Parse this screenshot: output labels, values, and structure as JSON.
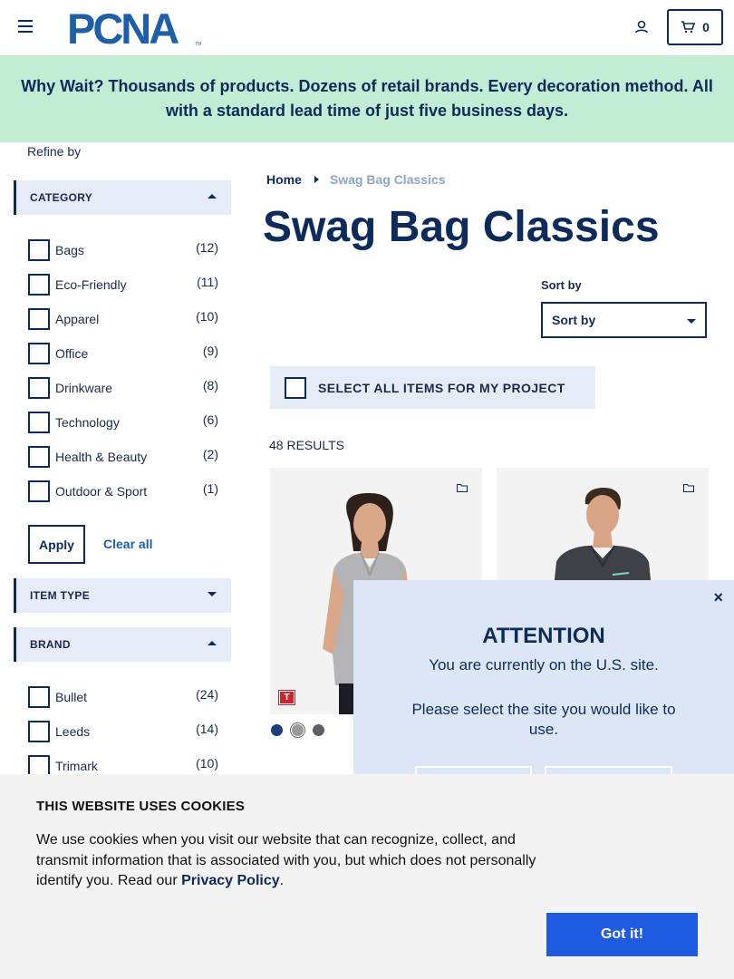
{
  "header": {
    "logo_text": "PCNA",
    "cart_count": "0"
  },
  "banner": {
    "text": "Why Wait? Thousands of products. Dozens of retail brands. Every decoration method. All with a standard lead time of just five business days."
  },
  "sidebar": {
    "refine_label": "Refine by",
    "category": {
      "label": "CATEGORY",
      "items": [
        {
          "name": "Bags",
          "count": "(12)"
        },
        {
          "name": "Eco-Friendly",
          "count": "(11)"
        },
        {
          "name": "Apparel",
          "count": "(10)"
        },
        {
          "name": "Office",
          "count": "(9)"
        },
        {
          "name": "Drinkware",
          "count": "(8)"
        },
        {
          "name": "Technology",
          "count": "(6)"
        },
        {
          "name": "Health & Beauty",
          "count": "(2)"
        },
        {
          "name": "Outdoor & Sport",
          "count": "(1)"
        }
      ],
      "apply_label": "Apply",
      "clear_label": "Clear all"
    },
    "item_type": {
      "label": "ITEM TYPE"
    },
    "brand": {
      "label": "BRAND",
      "items": [
        {
          "name": "Bullet",
          "count": "(24)"
        },
        {
          "name": "Leeds",
          "count": "(14)"
        },
        {
          "name": "Trimark",
          "count": "(10)"
        }
      ]
    }
  },
  "main": {
    "breadcrumb": {
      "home": "Home",
      "current": "Swag Bag Classics"
    },
    "title": "Swag Bag Classics",
    "sort": {
      "label": "Sort by",
      "value": "Sort by"
    },
    "select_all_label": "SELECT ALL ITEMS FOR MY PROJECT",
    "results_label": "48 RESULTS",
    "product_badge": "T",
    "swatch_colors": [
      "#1c3f7a",
      "#9a9a9a",
      "#5b5e62"
    ]
  },
  "attention": {
    "title": "ATTENTION",
    "line1": "You are currently on the U.S. site.",
    "line2": "Please select the site you would like to use.",
    "close": "×"
  },
  "cookie": {
    "title": "THIS WEBSITE USES COOKIES",
    "text": "We use cookies when you visit our website that can recognize, collect, and transmit information that is associated with you, but which does not personally identify you. Read our",
    "link": "Privacy Policy",
    "period": ".",
    "button": "Got it!"
  },
  "colors": {
    "navy": "#0d2b5a",
    "banner_green": "#c3ecd4",
    "facet_bg": "#e5ecf7",
    "cookie_button": "#1f5be0",
    "attention_bg": "#dce6f6"
  }
}
